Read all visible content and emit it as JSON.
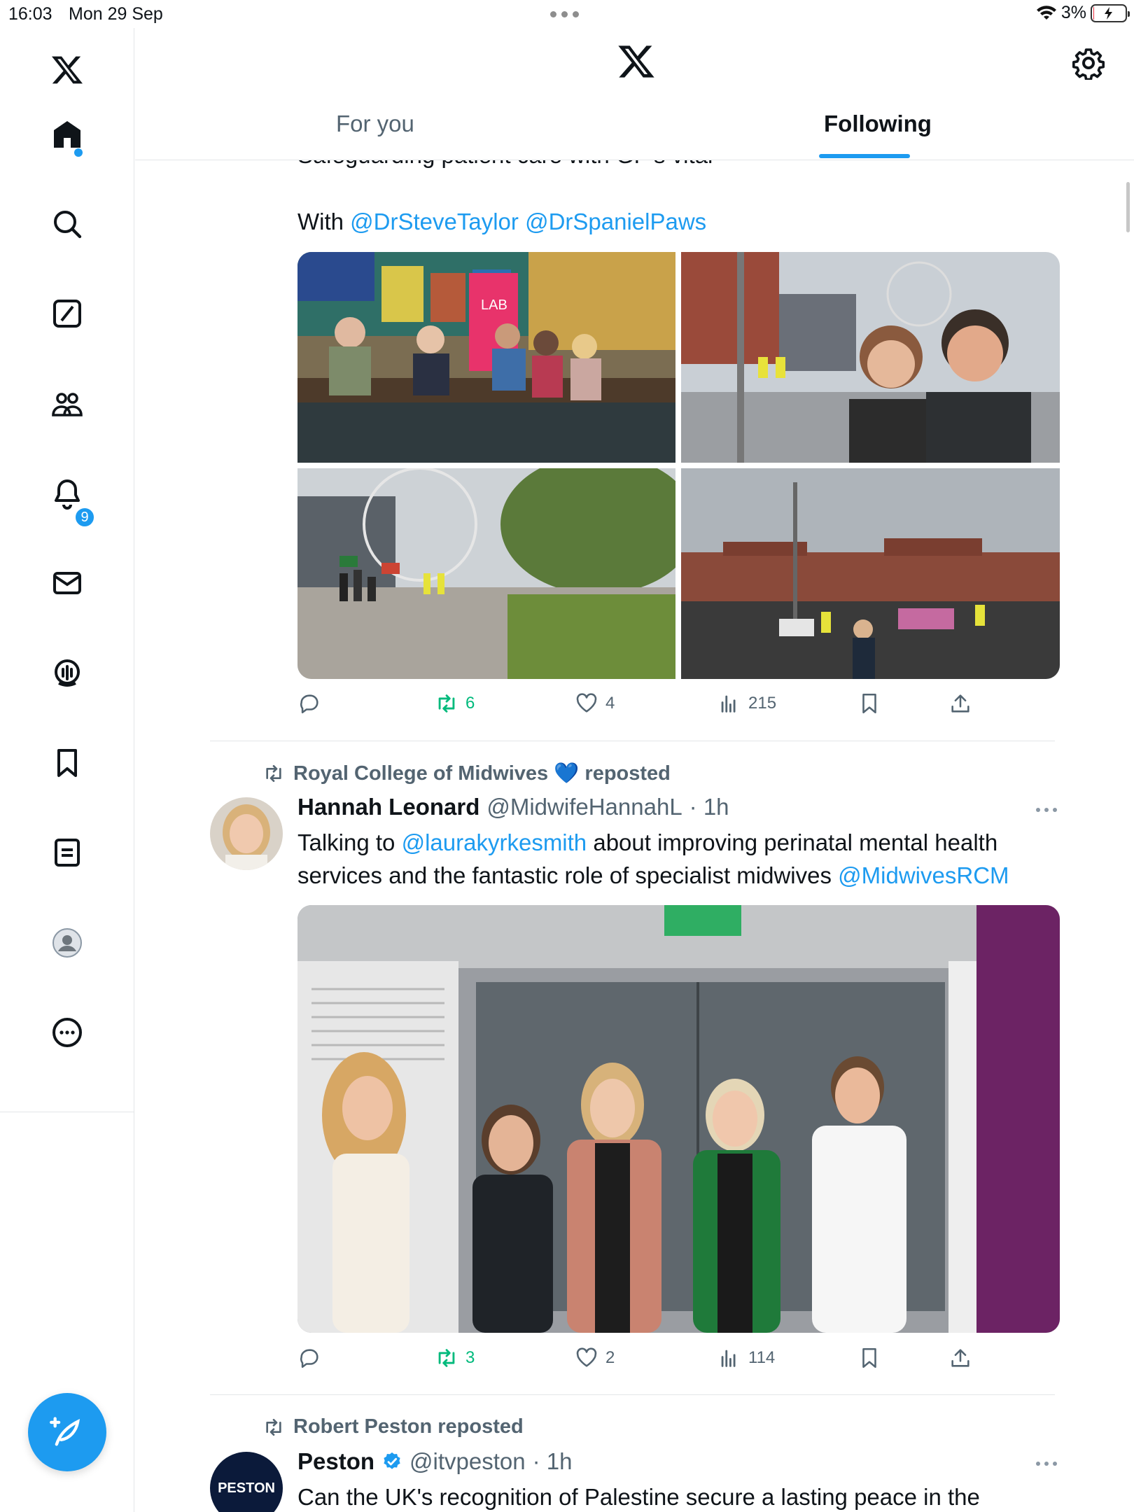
{
  "status_bar": {
    "time": "16:03",
    "date": "Mon 29 Sep",
    "battery": "3%",
    "battery_level": 0.03
  },
  "sidebar": {
    "items": [
      {
        "icon": "x-logo-icon"
      },
      {
        "icon": "home-icon"
      },
      {
        "icon": "search-icon"
      },
      {
        "icon": "grok-icon"
      },
      {
        "icon": "communities-icon"
      },
      {
        "icon": "notifications-icon"
      },
      {
        "icon": "messages-icon"
      },
      {
        "icon": "spaces-icon"
      },
      {
        "icon": "bookmarks-icon"
      },
      {
        "icon": "lists-icon"
      },
      {
        "icon": "profile-icon"
      },
      {
        "icon": "more-icon"
      }
    ],
    "notification_count": "9",
    "compose_icon": "compose-post-icon"
  },
  "header": {
    "tabs": [
      {
        "label": "For you"
      },
      {
        "label": "Following"
      }
    ],
    "active_tab": "Following"
  },
  "feed": {
    "post1": {
      "cut_text": "Safeguarding patient care with GP's vital",
      "with_label": "With",
      "mention1": "@DrSteveTaylor",
      "mention2": "@DrSpanielPaws",
      "replies": "",
      "reposts": "6",
      "likes": "4",
      "views": "215"
    },
    "post2": {
      "reposted_by": "Royal College of Midwives 💙 reposted",
      "name": "Hannah Leonard",
      "handle": "@MidwifeHannahL",
      "time": "· 1h",
      "text_a": "Talking to ",
      "mention_a": "@laurakyrkesmith",
      "text_b": " about improving perinatal mental health services and the fantastic role of specialist midwives ",
      "mention_b": "@MidwivesRCM",
      "reposts": "3",
      "likes": "2",
      "views": "114"
    },
    "post3": {
      "reposted_by": "Robert Peston reposted",
      "name": "Peston",
      "handle": "@itvpeston",
      "time": "· 1h",
      "avatar_text": "PESTON",
      "text": "Can the UK's recognition of Palestine secure a lasting peace in the"
    }
  },
  "colors": {
    "accent": "#1d9bf0",
    "repost_green": "#00ba7c",
    "muted": "#536471"
  }
}
